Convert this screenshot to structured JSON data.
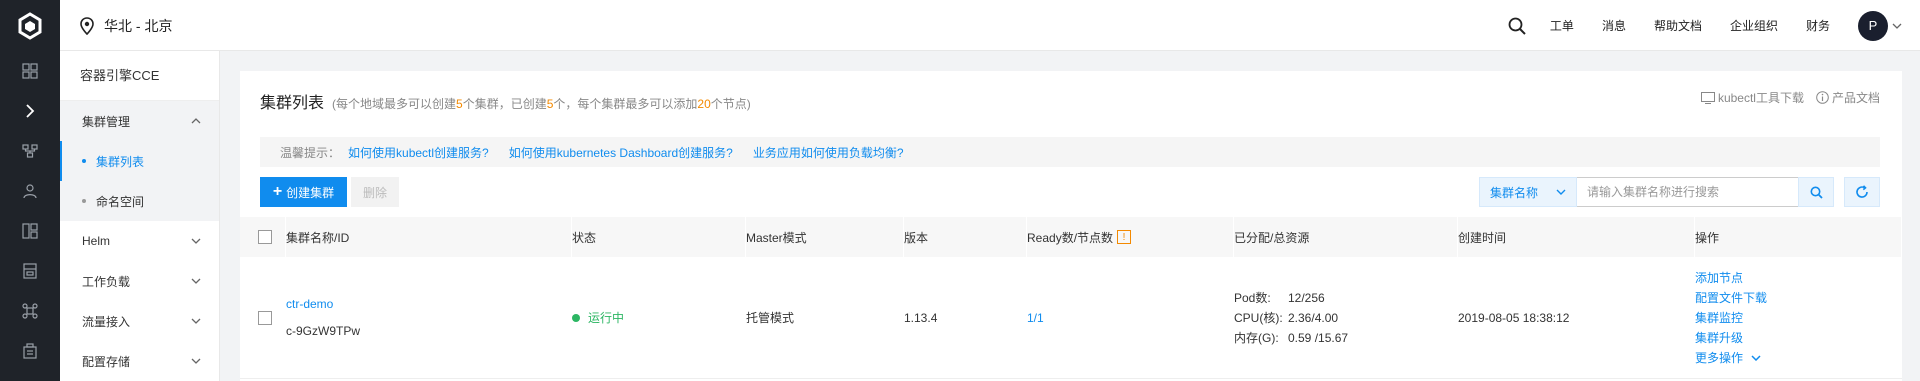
{
  "header": {
    "region": "华北 - 北京",
    "links": [
      "工单",
      "消息",
      "帮助文档",
      "企业组织",
      "财务"
    ],
    "avatar_letter": "P"
  },
  "sidebar": {
    "product": "容器引擎CCE",
    "groups": [
      {
        "label": "集群管理",
        "open": true
      },
      {
        "label": "Helm"
      },
      {
        "label": "工作负载"
      },
      {
        "label": "流量接入"
      },
      {
        "label": "配置存储"
      }
    ],
    "sub_items": [
      {
        "label": "集群列表",
        "active": true
      },
      {
        "label": "命名空间"
      }
    ]
  },
  "page": {
    "title": "集群列表",
    "hint_prefix": "(每个地域最多可以创建",
    "hint_n1": "5",
    "hint_mid1": "个集群，已创建",
    "hint_n2": "5",
    "hint_mid2": "个，每个集群最多可以添加",
    "hint_n3": "20",
    "hint_suffix": "个节点)",
    "kubectl_download": "kubectl工具下载",
    "product_docs": "产品文档"
  },
  "tips": {
    "label": "温馨提示：",
    "links": [
      "如何使用kubectl创建服务?",
      "如何使用kubernetes Dashboard创建服务?",
      "业务应用如何使用负载均衡?"
    ]
  },
  "toolbar": {
    "create": "创建集群",
    "delete": "删除",
    "search_field": "集群名称",
    "search_placeholder": "请输入集群名称进行搜索"
  },
  "table": {
    "columns": [
      "集群名称/ID",
      "状态",
      "Master模式",
      "版本",
      "Ready数/节点数",
      "已分配/总资源",
      "创建时间",
      "操作"
    ],
    "ready_warn": "!",
    "rows": [
      {
        "name": "ctr-demo",
        "id": "c-9GzW9TPw",
        "status": "运行中",
        "master_mode": "托管模式",
        "version": "1.13.4",
        "ready": "1/1",
        "res_pod_k": "Pod数:",
        "res_pod_v": "12/256",
        "res_cpu_k": "CPU(核):",
        "res_cpu_v": "2.36/4.00",
        "res_mem_k": "内存(G):",
        "res_mem_v": "0.59 /15.67",
        "created": "2019-08-05 18:38:12",
        "ops": [
          "添加节点",
          "配置文件下载",
          "集群监控",
          "集群升级"
        ],
        "more": "更多操作"
      }
    ]
  }
}
